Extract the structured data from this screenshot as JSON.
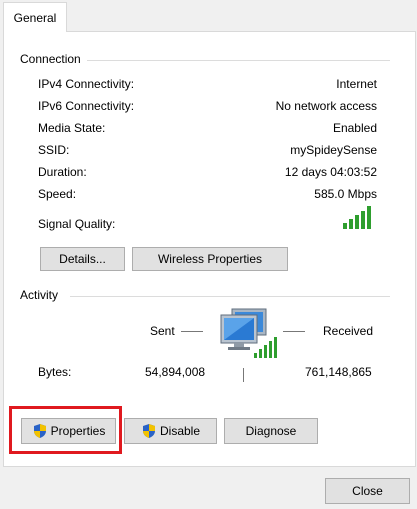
{
  "tabs": [
    {
      "label": "General"
    }
  ],
  "connection": {
    "title": "Connection",
    "rows": [
      {
        "label": "IPv4 Connectivity:",
        "value": "Internet"
      },
      {
        "label": "IPv6 Connectivity:",
        "value": "No network access"
      },
      {
        "label": "Media State:",
        "value": "Enabled"
      },
      {
        "label": "SSID:",
        "value": "mySpideySense"
      },
      {
        "label": "Duration:",
        "value": "12 days 04:03:52"
      },
      {
        "label": "Speed:",
        "value": "585.0 Mbps"
      }
    ],
    "signal_label": "Signal Quality:",
    "signal_bars": 5,
    "signal_bars_max": 5,
    "buttons": {
      "details": "Details...",
      "wireless": "Wireless Properties"
    }
  },
  "activity": {
    "title": "Activity",
    "sent_label": "Sent",
    "received_label": "Received",
    "bytes_label": "Bytes:",
    "bytes_sent": "54,894,008",
    "bytes_received": "761,148,865"
  },
  "actions": {
    "properties": "Properties",
    "disable": "Disable",
    "diagnose": "Diagnose"
  },
  "footer": {
    "close": "Close"
  },
  "colors": {
    "accent_highlight": "#e0191f",
    "signal_green": "#2e9e2e",
    "shield_blue": "#2a63c7",
    "shield_yellow": "#f2c200"
  },
  "icons": [
    "network-computers-icon",
    "signal-strength-icon",
    "uac-shield-icon"
  ]
}
